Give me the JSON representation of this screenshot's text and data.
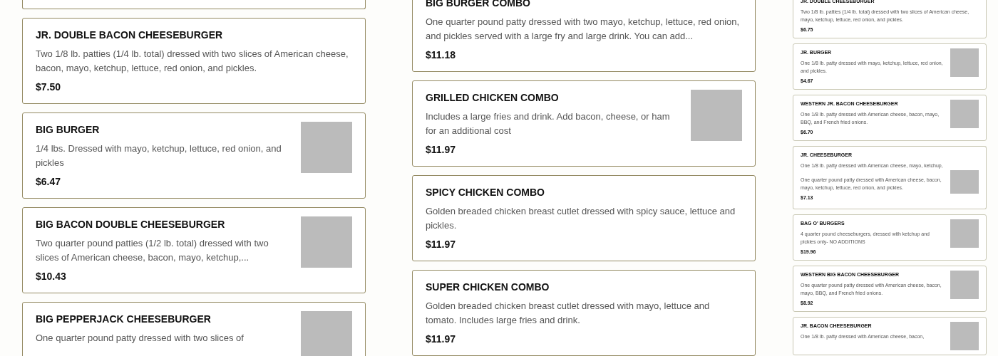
{
  "main_columns": [
    {
      "items": [
        {
          "kind": "edge"
        },
        {
          "kind": "card",
          "title": "JR. DOUBLE BACON CHEESEBURGER",
          "description": "Two 1/8 lb. patties (1/4 lb. total) dressed with two slices of American cheese, bacon, mayo, ketchup, lettuce, red onion, and pickles.",
          "price": "$7.50",
          "has_image": false
        },
        {
          "kind": "card",
          "title": "BIG BURGER",
          "description": "1/4 lbs. Dressed with mayo, ketchup, lettuce, red onion, and pickles",
          "price": "$6.47",
          "has_image": true
        },
        {
          "kind": "card",
          "title": "BIG BACON DOUBLE CHEESEBURGER",
          "description": "Two quarter pound patties (1/2 lb. total) dressed with two slices of American cheese, bacon, mayo, ketchup,...",
          "price": "$10.43",
          "has_image": true
        },
        {
          "kind": "card",
          "title": "BIG PEPPERJACK CHEESEBURGER",
          "description": "One quarter pound patty dressed with two slices of",
          "has_image": true
        }
      ]
    },
    {
      "items": [
        {
          "kind": "card",
          "title": "BIG BURGER COMBO",
          "description": "One quarter pound patty dressed with two mayo, ketchup, lettuce, red onion, and pickles served with a large fry and large drink. You can add...",
          "price": "$11.18",
          "has_image": false
        },
        {
          "kind": "card",
          "title": "GRILLED CHICKEN COMBO",
          "description": "Includes a large fries and drink. Add bacon, cheese, or ham for an additional cost",
          "price": "$11.97",
          "has_image": true
        },
        {
          "kind": "card",
          "title": "SPICY CHICKEN COMBO",
          "description": "Golden breaded chicken breast cutlet dressed with spicy sauce, lettuce and pickles.",
          "price": "$11.97",
          "has_image": false
        },
        {
          "kind": "card",
          "title": "SUPER CHICKEN COMBO",
          "description": "Golden breaded chicken breast cutlet dressed with mayo, lettuce and tomato. Includes large fries and drink.",
          "price": "$11.97",
          "has_image": false
        }
      ]
    }
  ],
  "side_column": {
    "items": [
      {
        "kind": "card",
        "title": "JR. DOUBLE CHEESEBURGER",
        "description": "Two 1/8 lb. patties (1/4 lb. total) dressed with two slices of American cheese, mayo, ketchup, lettuce, red onion, and pickles.",
        "price": "$6.75",
        "has_image": false
      },
      {
        "kind": "card",
        "title": "JR. BURGER",
        "description": "One 1/8 lb. patty dressed with mayo, ketchup, lettuce, red onion, and pickles.",
        "price": "$4.67",
        "has_image": true
      },
      {
        "kind": "card",
        "title": "WESTERN JR. BACON CHEESEBURGER",
        "description": "One 1/8 lb. patty dressed with American cheese, bacon, mayo, BBQ, and French fried onions.",
        "price": "$6.70",
        "has_image": true
      },
      {
        "kind": "cut-bottom",
        "title": "JR. CHEESEBURGER",
        "description": "One 1/8 lb. patty dressed with American cheese, mayo, ketchup,",
        "has_image": false
      },
      {
        "kind": "cut-top",
        "description": "One quarter pound patty dressed with American cheese, bacon, mayo, ketchup, lettuce, red onion, and pickles.",
        "price": "$7.13",
        "has_image": true
      },
      {
        "kind": "card",
        "title": "BAG O' BURGERS",
        "description": "4 quarter pound cheeseburgers, dressed with ketchup and pickles only- NO ADDITIONS",
        "price": "$19.96",
        "has_image": true
      },
      {
        "kind": "card",
        "title": "WESTERN BIG BACON CHEESEBURGER",
        "description": "One quarter pound patty dressed with American cheese, bacon, mayo, BBQ, and French fried onions.",
        "price": "$8.92",
        "has_image": true
      },
      {
        "kind": "card",
        "title": "JR. BACON CHEESEBURGER",
        "description": "One 1/8 lb. patty dressed with American cheese, bacon,",
        "has_image": true
      }
    ]
  }
}
